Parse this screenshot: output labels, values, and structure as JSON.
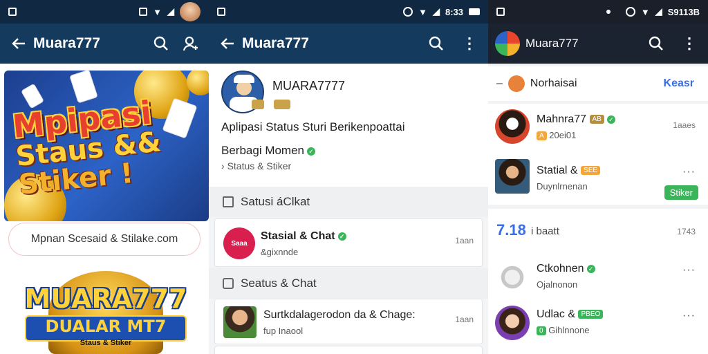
{
  "screen1": {
    "title": "Muara777",
    "banner": {
      "line1": "Mpipasi",
      "line2": "Staus &&",
      "line3": "Stiker !"
    },
    "pill_text": "Mpnan Scesaid & Stilake.com",
    "logo": {
      "line1": "MUARA777",
      "line2": "DUALAR MT7",
      "line3": "Staus & Stiker"
    }
  },
  "screen2": {
    "title": "Muara777",
    "status_time": "8:33",
    "profile": {
      "name": "MUARA7777",
      "description": "Aplipasi Status Sturi Berikenpoattai",
      "subtitle": "Berbagi Momen",
      "tagline": "Status & Stiker"
    },
    "section1": "Satusi áClkat",
    "row1": {
      "avatar_text": "Saaa",
      "name": "Stasial & Chat",
      "sub": "&gixnnde",
      "time": "1aan"
    },
    "section2": "Seatus & Chat",
    "row2": {
      "name": "Surtkdalagerodon da & Chage:",
      "sub": "fup Inaool",
      "time": "1aan"
    }
  },
  "screen3": {
    "title": "Muara777",
    "status_time": "S9113B",
    "header_label": "Norhaisai",
    "header_link": "Keasr",
    "items": [
      {
        "name": "Mahnra77",
        "badge": "AB",
        "sub_badge": "A",
        "sub": "20ei01",
        "time": "1aaes"
      },
      {
        "name": "Statial &",
        "badge": "SEE",
        "sub": "Duynlrnenan",
        "action": "Stiker"
      },
      {
        "name": "Ctkohnen",
        "sub": "Ojalnonon"
      },
      {
        "name": "Udlac &",
        "badge": "PBEO",
        "sub_badge": "0",
        "sub": "Gihlnnone"
      }
    ],
    "divider": {
      "number": "7.18",
      "label": "i baatt",
      "time": "1743"
    },
    "colors": {
      "accent_blue": "#3a6ee8",
      "verified_green": "#3bb55a",
      "badge_orange": "#f4a63a"
    }
  }
}
